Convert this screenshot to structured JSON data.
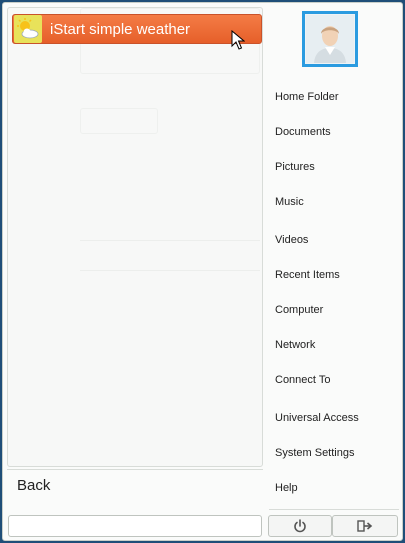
{
  "favorites": [
    {
      "label": "iStart simple weather",
      "icon": "weather-sun-cloud-icon",
      "highlighted": true
    }
  ],
  "back_label": "Back",
  "search": {
    "value": "",
    "placeholder": ""
  },
  "user": {
    "avatar_icon": "user-avatar-icon"
  },
  "places": [
    "Home Folder",
    "Documents",
    "Pictures",
    "Music",
    "Videos",
    "Recent Items",
    "Computer",
    "Network",
    "Connect To",
    "Universal Access",
    "System Settings",
    "Help"
  ],
  "session_buttons": {
    "power_icon": "power-icon",
    "logout_icon": "logout-icon"
  },
  "colors": {
    "highlight": "#ee6a35",
    "avatar_border": "#2b9be0",
    "desktop": "#1f4e78"
  }
}
